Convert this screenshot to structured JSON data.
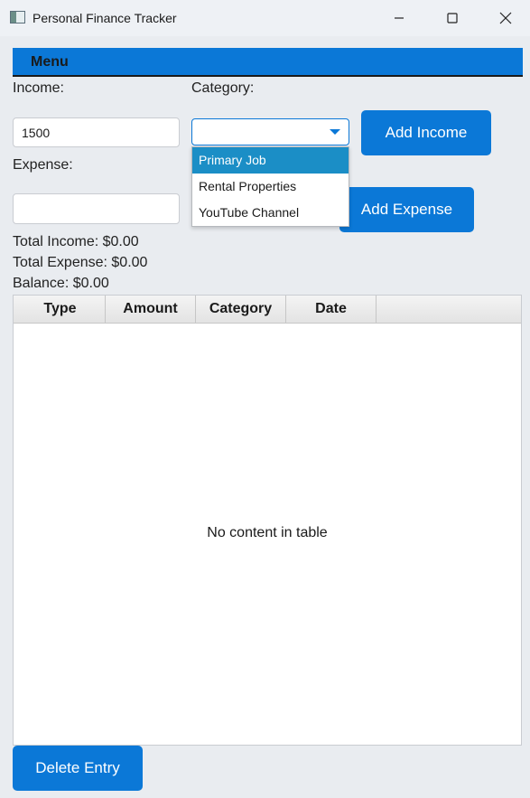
{
  "window": {
    "title": "Personal Finance Tracker",
    "controls": [
      "minimize-icon",
      "maximize-icon",
      "close-icon"
    ]
  },
  "menu": {
    "label": "Menu"
  },
  "form": {
    "income_label": "Income:",
    "income_value": "1500",
    "category_label": "Category:",
    "category_value": "",
    "add_income_label": "Add Income",
    "expense_label": "Expense:",
    "expense_value": "",
    "add_expense_label": "Add Expense"
  },
  "dropdown": {
    "options": [
      "Primary Job",
      "Rental Properties",
      "YouTube Channel"
    ],
    "highlighted": "Primary Job"
  },
  "totals": {
    "income": "Total Income: $0.00",
    "expense": "Total Expense: $0.00",
    "balance": "Balance: $0.00"
  },
  "table": {
    "columns": [
      "Type",
      "Amount",
      "Category",
      "Date"
    ],
    "empty_message": "No content in table"
  },
  "actions": {
    "delete_label": "Delete Entry"
  },
  "colors": {
    "accent": "#0b78d7",
    "selection": "#1b8ec6",
    "background": "#e9ecf0"
  }
}
